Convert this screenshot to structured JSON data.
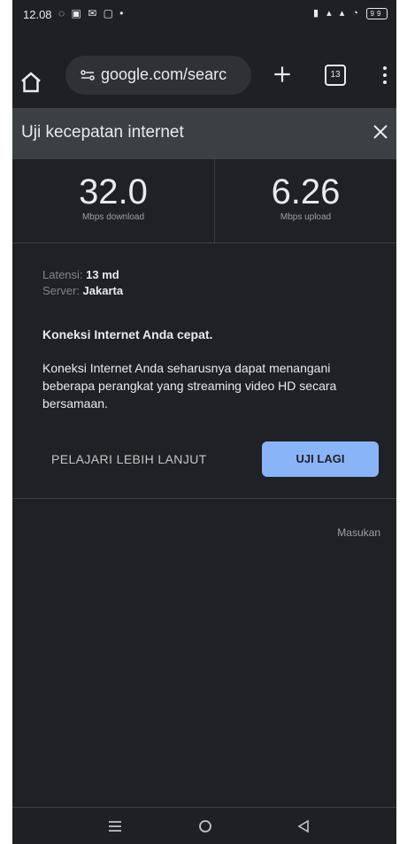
{
  "status_bar": {
    "time": "12.08",
    "left_icons": [
      "whatsapp-icon",
      "lock-icon",
      "mail-icon",
      "image-icon",
      "dot-icon"
    ],
    "right_icons": [
      "vibrate-icon",
      "signal-icon",
      "signal-icon",
      "wifi-icon"
    ],
    "battery": "99"
  },
  "browser": {
    "url": "google.com/searc",
    "tab_count": "13",
    "icons": [
      "home-icon",
      "site-settings-icon",
      "plus-icon",
      "tabs-icon",
      "menu-icon"
    ]
  },
  "speedtest": {
    "title": "Uji kecepatan internet",
    "download_value": "32.0",
    "download_label": "Mbps download",
    "upload_value": "6.26",
    "upload_label": "Mbps upload",
    "latency_key": "Latensi:",
    "latency_value": "13 md",
    "server_key": "Server:",
    "server_value": "Jakarta",
    "verdict": "Koneksi Internet Anda cepat.",
    "description": "Koneksi Internet Anda seharusnya dapat menangani beberapa perangkat yang streaming video HD secara bersamaan.",
    "learn_more": "PELAJARI LEBIH LANJUT",
    "retry": "UJI LAGI",
    "feedback": "Masukan"
  },
  "nav": [
    "recent-apps-icon",
    "home-circle-icon",
    "back-icon"
  ],
  "colors": {
    "background": "#202124",
    "accent": "#8ab4f8",
    "header": "#3c4043"
  }
}
